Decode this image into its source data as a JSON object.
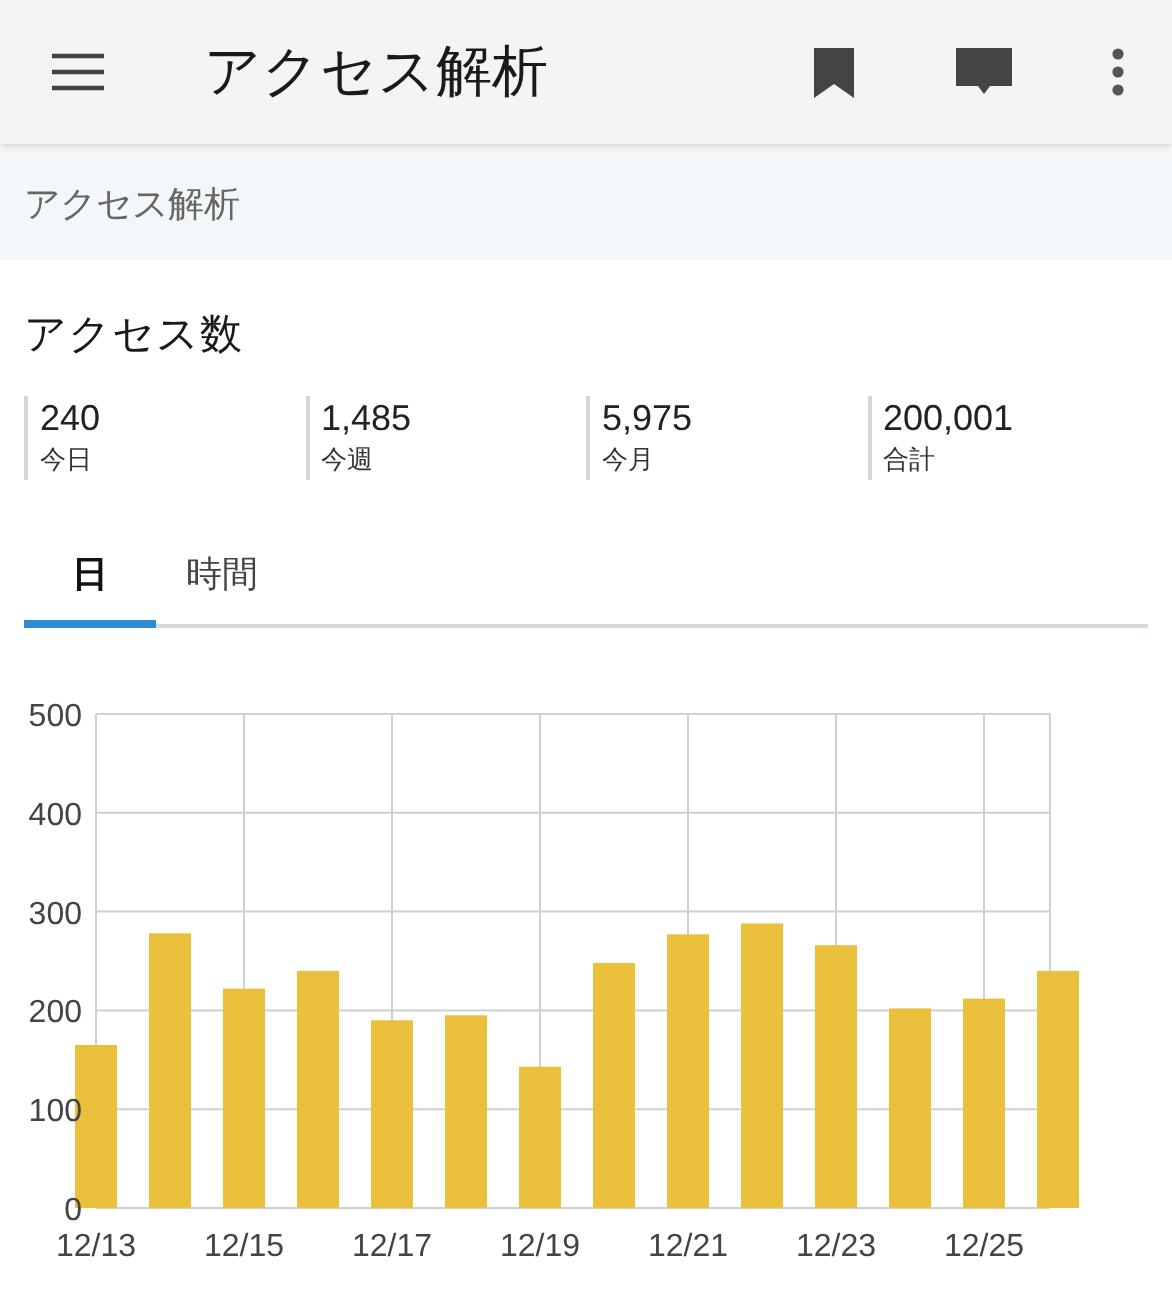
{
  "app_bar": {
    "title": "アクセス解析"
  },
  "breadcrumb": "アクセス解析",
  "section": {
    "title": "アクセス数",
    "stats": [
      {
        "value": "240",
        "label": "今日"
      },
      {
        "value": "1,485",
        "label": "今週"
      },
      {
        "value": "5,975",
        "label": "今月"
      },
      {
        "value": "200,001",
        "label": "合計"
      }
    ]
  },
  "tabs": [
    {
      "label": "日",
      "selected": true
    },
    {
      "label": "時間",
      "selected": false
    }
  ],
  "chart_data": {
    "type": "bar",
    "categories": [
      "12/13",
      null,
      "12/15",
      null,
      "12/17",
      null,
      "12/19",
      null,
      "12/21",
      null,
      "12/23",
      null,
      "12/25",
      null
    ],
    "series": [
      {
        "color": "#e9bf3c",
        "values": [
          165,
          278,
          222,
          240,
          190,
          195,
          143,
          248,
          277,
          288,
          266,
          202,
          212,
          240
        ]
      }
    ],
    "grid": true,
    "ylim": [
      0,
      500
    ],
    "yticks": [
      0,
      100,
      200,
      300,
      400,
      500
    ]
  }
}
